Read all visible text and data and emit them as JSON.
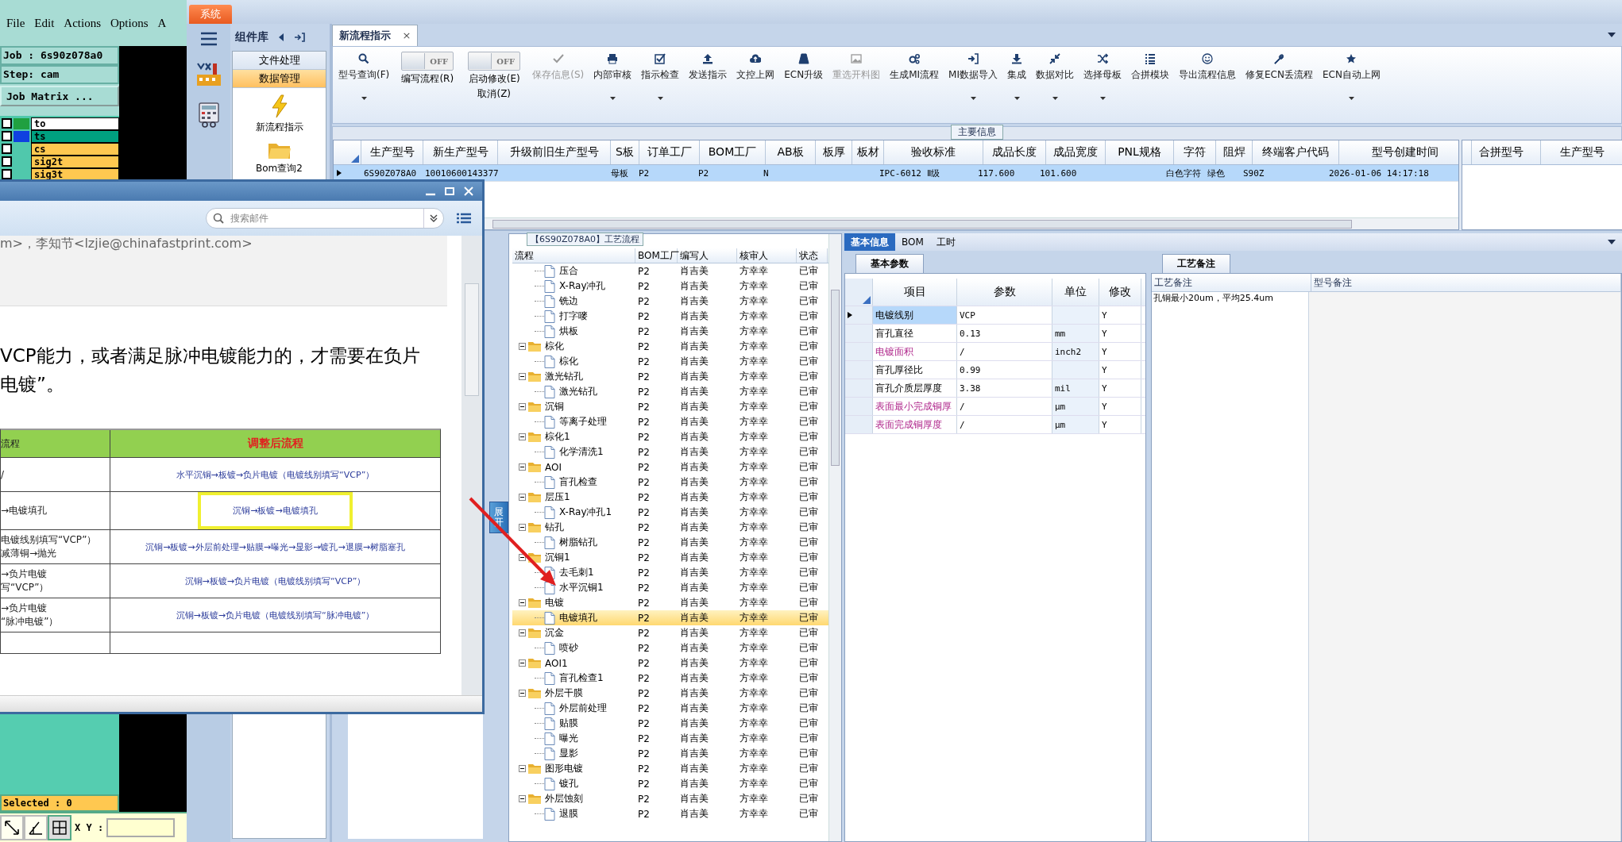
{
  "cam": {
    "menu": [
      "File",
      "Edit",
      "Actions",
      "Options",
      "A"
    ],
    "job": "Job : 6s90z078a0",
    "step": "Step: cam",
    "matrix_button": "Job Matrix ...",
    "layers": [
      {
        "name": "to",
        "color": "#ffffff",
        "checked": false,
        "swatch": {
          "color": "#20a040"
        }
      },
      {
        "name": "ts",
        "color": "#00a080",
        "checked": false,
        "swatch": {
          "color": "#1040e0"
        }
      },
      {
        "name": "cs",
        "color": "#ffc850",
        "checked": false
      },
      {
        "name": "sig2t",
        "color": "#ffc850",
        "checked": false
      },
      {
        "name": "sig3t",
        "color": "#ffc850",
        "checked": false
      }
    ],
    "selected_text": "Selected : 0",
    "xy_label": "X Y :"
  },
  "app": {
    "system_tab": "系统",
    "library": {
      "title": "组件库",
      "categories": [
        {
          "label": "文件处理",
          "selected": false
        },
        {
          "label": "数据管理",
          "selected": true
        }
      ],
      "items": [
        {
          "label": "新流程指示",
          "kind": "lightning"
        },
        {
          "label": "Bom查询2",
          "kind": "folder"
        }
      ]
    },
    "doc_tab": {
      "label": "新流程指示",
      "close": "×"
    },
    "toolbar": [
      {
        "kind": "button",
        "label": "型号查询(F)",
        "dropdown": true,
        "disabled": false
      },
      {
        "kind": "toggle",
        "label": "编写流程(R)",
        "state_text": "OFF",
        "on": false
      },
      {
        "kind": "toggle",
        "label": "启动修改(E)",
        "sublabel": "取消(Z)",
        "state_text": "OFF",
        "on": false
      },
      {
        "kind": "button",
        "label": "保存信息(S)",
        "dropdown": false,
        "disabled": true
      },
      {
        "kind": "button",
        "label": "内部审核",
        "dropdown": true,
        "disabled": false
      },
      {
        "kind": "button",
        "label": "指示检查",
        "dropdown": true,
        "disabled": false
      },
      {
        "kind": "button",
        "label": "发送指示",
        "dropdown": false,
        "disabled": false
      },
      {
        "kind": "button",
        "label": "文控上网",
        "dropdown": false,
        "disabled": false
      },
      {
        "kind": "button",
        "label": "ECN升级",
        "dropdown": false,
        "disabled": false
      },
      {
        "kind": "button",
        "label": "重选开料图",
        "dropdown": false,
        "disabled": true
      },
      {
        "kind": "button",
        "label": "生成MI流程",
        "dropdown": false,
        "disabled": false
      },
      {
        "kind": "button",
        "label": "MI数据导入",
        "dropdown": true,
        "disabled": false
      },
      {
        "kind": "button",
        "label": "集成",
        "dropdown": true,
        "disabled": false
      },
      {
        "kind": "button",
        "label": "数据对比",
        "dropdown": true,
        "disabled": false
      },
      {
        "kind": "button",
        "label": "选择母板",
        "dropdown": true,
        "disabled": false
      },
      {
        "kind": "button",
        "label": "合拼模块",
        "dropdown": false,
        "disabled": false
      },
      {
        "kind": "button",
        "label": "导出流程信息",
        "dropdown": false,
        "disabled": false
      },
      {
        "kind": "button",
        "label": "修复ECN丢流程",
        "dropdown": false,
        "disabled": false
      },
      {
        "kind": "button",
        "label": "ECN自动上网",
        "dropdown": true,
        "disabled": false
      }
    ],
    "main_info": {
      "title": "主要信息",
      "columns": [
        "生产型号",
        "新生产型号",
        "升级前旧生产型号",
        "S板",
        "订单工厂",
        "BOM工厂",
        "AB板",
        "板厚",
        "板材",
        "验收标准",
        "成品长度",
        "成品宽度",
        "PNL规格",
        "字符",
        "阻焊",
        "终端客户代码",
        "型号创建时间"
      ],
      "rows": [
        {
          "selected": true,
          "cells": [
            "6S90Z078A0",
            "10010600143377",
            null,
            "母板",
            "P2",
            "P2",
            "N",
            null,
            null,
            "IPC-6012 Ⅱ级",
            "117.600",
            "101.600",
            null,
            "白色字符",
            "绿色",
            "S90Z",
            "2026-01-06 14:17:18"
          ]
        }
      ],
      "merge_columns": [
        "合拼型号",
        "生产型号"
      ]
    },
    "expand_button": "展开",
    "process": {
      "title": "【6S90Z078A0】工艺流程",
      "columns": [
        "流程",
        "BOM工厂",
        "编写人",
        "核审人",
        "状态"
      ],
      "tree": [
        {
          "children": [
            {
              "label": "压合",
              "bom": "P2",
              "writer": "肖吉美",
              "reviewer": "方幸幸",
              "status": "已审",
              "selected": false
            },
            {
              "label": "X-Ray冲孔",
              "bom": "P2",
              "writer": "肖吉美",
              "reviewer": "方幸幸",
              "status": "已审",
              "selected": false
            },
            {
              "label": "铣边",
              "bom": "P2",
              "writer": "肖吉美",
              "reviewer": "方幸幸",
              "status": "已审",
              "selected": false
            },
            {
              "label": "打字嘜",
              "bom": "P2",
              "writer": "肖吉美",
              "reviewer": "方幸幸",
              "status": "已审",
              "selected": false
            },
            {
              "label": "烘板",
              "bom": "P2",
              "writer": "肖吉美",
              "reviewer": "方幸幸",
              "status": "已审",
              "selected": false
            }
          ]
        },
        {
          "label": "棕化",
          "bom": "P2",
          "writer": "肖吉美",
          "reviewer": "方幸幸",
          "status": "已审",
          "selected": false,
          "children": [
            {
              "label": "棕化",
              "bom": "P2",
              "writer": "肖吉美",
              "reviewer": "方幸幸",
              "status": "已审",
              "selected": false
            }
          ]
        },
        {
          "label": "激光钻孔",
          "bom": "P2",
          "writer": "肖吉美",
          "reviewer": "方幸幸",
          "status": "已审",
          "selected": false,
          "children": [
            {
              "label": "激光钻孔",
              "bom": "P2",
              "writer": "肖吉美",
              "reviewer": "方幸幸",
              "status": "已审",
              "selected": false
            }
          ]
        },
        {
          "label": "沉铜",
          "bom": "P2",
          "writer": "肖吉美",
          "reviewer": "方幸幸",
          "status": "已审",
          "selected": false,
          "children": [
            {
              "label": "等离子处理",
              "bom": "P2",
              "writer": "肖吉美",
              "reviewer": "方幸幸",
              "status": "已审",
              "selected": false
            }
          ]
        },
        {
          "label": "棕化1",
          "bom": "P2",
          "writer": "肖吉美",
          "reviewer": "方幸幸",
          "status": "已审",
          "selected": false,
          "children": [
            {
              "label": "化学清洗1",
              "bom": "P2",
              "writer": "肖吉美",
              "reviewer": "方幸幸",
              "status": "已审",
              "selected": false
            }
          ]
        },
        {
          "label": "AOI",
          "bom": "P2",
          "writer": "肖吉美",
          "reviewer": "方幸幸",
          "status": "已审",
          "selected": false,
          "children": [
            {
              "label": "盲孔检查",
              "bom": "P2",
              "writer": "肖吉美",
              "reviewer": "方幸幸",
              "status": "已审",
              "selected": false
            }
          ]
        },
        {
          "label": "层压1",
          "bom": "P2",
          "writer": "肖吉美",
          "reviewer": "方幸幸",
          "status": "已审",
          "selected": false,
          "children": [
            {
              "label": "X-Ray冲孔1",
              "bom": "P2",
              "writer": "肖吉美",
              "reviewer": "方幸幸",
              "status": "已审",
              "selected": false
            }
          ]
        },
        {
          "label": "钻孔",
          "bom": "P2",
          "writer": "肖吉美",
          "reviewer": "方幸幸",
          "status": "已审",
          "selected": false,
          "children": [
            {
              "label": "树脂钻孔",
              "bom": "P2",
              "writer": "肖吉美",
              "reviewer": "方幸幸",
              "status": "已审",
              "selected": false
            }
          ]
        },
        {
          "label": "沉铜1",
          "bom": "P2",
          "writer": "肖吉美",
          "reviewer": "方幸幸",
          "status": "已审",
          "selected": false,
          "children": [
            {
              "label": "去毛刺1",
              "bom": "P2",
              "writer": "肖吉美",
              "reviewer": "方幸幸",
              "status": "已审",
              "selected": false
            },
            {
              "label": "水平沉铜1",
              "bom": "P2",
              "writer": "肖吉美",
              "reviewer": "方幸幸",
              "status": "已审",
              "selected": false
            }
          ]
        },
        {
          "label": "电镀",
          "bom": "P2",
          "writer": "肖吉美",
          "reviewer": "方幸幸",
          "status": "已审",
          "selected": false,
          "children": [
            {
              "label": "电镀填孔",
              "bom": "P2",
              "writer": "肖吉美",
              "reviewer": "方幸幸",
              "status": "已审",
              "selected": true
            }
          ]
        },
        {
          "label": "沉金",
          "bom": "P2",
          "writer": "肖吉美",
          "reviewer": "方幸幸",
          "status": "已审",
          "selected": false,
          "children": [
            {
              "label": "喷砂",
              "bom": "P2",
              "writer": "肖吉美",
              "reviewer": "方幸幸",
              "status": "已审",
              "selected": false
            }
          ]
        },
        {
          "label": "AOI1",
          "bom": "P2",
          "writer": "肖吉美",
          "reviewer": "方幸幸",
          "status": "已审",
          "selected": false,
          "children": [
            {
              "label": "盲孔检查1",
              "bom": "P2",
              "writer": "肖吉美",
              "reviewer": "方幸幸",
              "status": "已审",
              "selected": false
            }
          ]
        },
        {
          "label": "外层干膜",
          "bom": "P2",
          "writer": "肖吉美",
          "reviewer": "方幸幸",
          "status": "已审",
          "selected": false,
          "children": [
            {
              "label": "外层前处理",
              "bom": "P2",
              "writer": "肖吉美",
              "reviewer": "方幸幸",
              "status": "已审",
              "selected": false
            },
            {
              "label": "贴膜",
              "bom": "P2",
              "writer": "肖吉美",
              "reviewer": "方幸幸",
              "status": "已审",
              "selected": false
            },
            {
              "label": "曝光",
              "bom": "P2",
              "writer": "肖吉美",
              "reviewer": "方幸幸",
              "status": "已审",
              "selected": false
            },
            {
              "label": "显影",
              "bom": "P2",
              "writer": "肖吉美",
              "reviewer": "方幸幸",
              "status": "已审",
              "selected": false
            }
          ]
        },
        {
          "label": "图形电镀",
          "bom": "P2",
          "writer": "肖吉美",
          "reviewer": "方幸幸",
          "status": "已审",
          "selected": false,
          "children": [
            {
              "label": "镀孔",
              "bom": "P2",
              "writer": "肖吉美",
              "reviewer": "方幸幸",
              "status": "已审",
              "selected": false
            }
          ]
        },
        {
          "label": "外层蚀刻",
          "bom": "P2",
          "writer": "肖吉美",
          "reviewer": "方幸幸",
          "status": "已审",
          "selected": false,
          "children": [
            {
              "label": "退膜",
              "bom": "P2",
              "writer": "肖吉美",
              "reviewer": "方幸幸",
              "status": "已审",
              "selected": false
            }
          ]
        }
      ]
    },
    "detail": {
      "tabs": [
        {
          "label": "基本信息",
          "selected": true
        },
        {
          "label": "BOM",
          "selected": false
        },
        {
          "label": "工时",
          "selected": false
        }
      ],
      "params": {
        "tab": "基本参数",
        "columns": [
          "项目",
          "参数",
          "单位",
          "修改"
        ],
        "rows": [
          {
            "item": "电镀线别",
            "value": "VCP",
            "modify": "Y",
            "highlighted": false,
            "selected": true
          },
          {
            "item": "盲孔直径",
            "value": "0.13",
            "unit": "mm",
            "modify": "Y",
            "highlighted": false,
            "selected": false
          },
          {
            "item": "电镀面积",
            "value": "/",
            "unit": "inch2",
            "modify": "Y",
            "highlighted": true,
            "selected": false
          },
          {
            "item": "盲孔厚径比",
            "value": "0.99",
            "modify": "Y",
            "highlighted": false,
            "selected": false
          },
          {
            "item": "盲孔介质层厚度",
            "value": "3.38",
            "unit": "mil",
            "modify": "Y",
            "highlighted": false,
            "selected": false
          },
          {
            "item": "表面最小完成铜厚",
            "value": "/",
            "unit": "μm",
            "modify": "Y",
            "highlighted": true,
            "selected": false
          },
          {
            "item": "表面完成铜厚度",
            "value": "/",
            "unit": "μm",
            "modify": "Y",
            "highlighted": true,
            "selected": false
          }
        ]
      },
      "notes": {
        "tab": "工艺备注",
        "columns": [
          "工艺备注",
          "型号备注"
        ],
        "values": [
          "孔铜最小20um，平均25.4um"
        ]
      }
    }
  },
  "email": {
    "search_placeholder": "搜索邮件",
    "sender": "m>，李知节<lzjie@chinafastprint.com>",
    "body": [
      "VCP能力，或者满足脉冲电镀能力的，才需要在负片",
      "电镀”。"
    ],
    "table": {
      "columns": [
        "流程",
        "调整后流程"
      ],
      "rows": [
        {
          "left": [
            "/"
          ],
          "right": "水平沉铜→板镀→负片电镀（电镀线别填写“VCP”）",
          "annotated": false
        },
        {
          "left": [
            "→电镀填孔"
          ],
          "right": "沉铜→板镀→电镀填孔",
          "annotated": true
        },
        {
          "left": [
            "电镀线别填写“VCP”）",
            "减薄铜→抛光"
          ],
          "right": "沉铜→板镀→外层前处理→贴膜→曝光→显影→镀孔→退膜→树脂塞孔",
          "annotated": false
        },
        {
          "left": [
            "→负片电镀",
            "写“VCP”）"
          ],
          "right": "沉铜→板镀→负片电镀（电镀线别填写“VCP”）",
          "annotated": false
        },
        {
          "left": [
            "→负片电镀",
            "“脉冲电镀”）"
          ],
          "right": "沉铜→板镀→负片电镀（电镀线别填写“脉冲电镀”）",
          "annotated": false
        }
      ]
    }
  }
}
